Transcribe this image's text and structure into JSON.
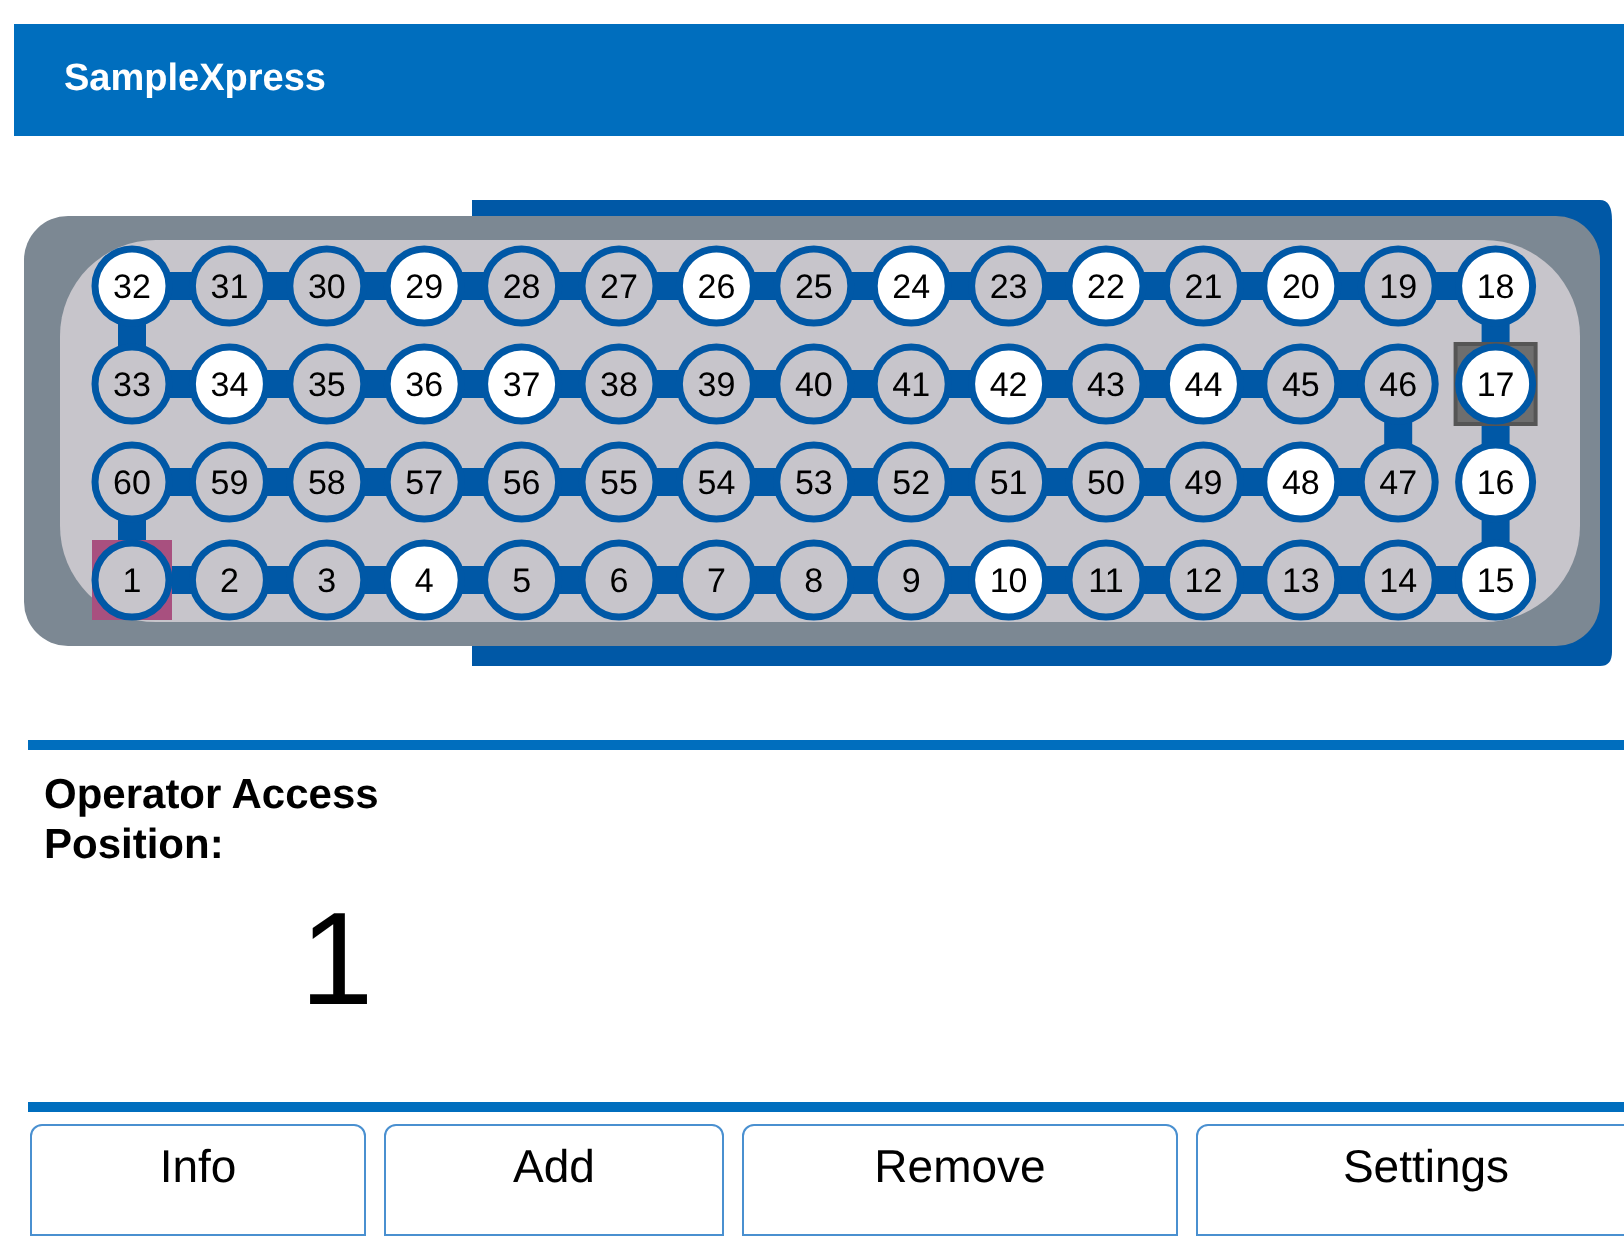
{
  "window": {
    "title": "SampleXpress"
  },
  "positions": [
    {
      "label": "32",
      "occupied": true,
      "selected": false,
      "marked": false
    },
    {
      "label": "31",
      "occupied": false,
      "selected": false,
      "marked": false
    },
    {
      "label": "30",
      "occupied": false,
      "selected": false,
      "marked": false
    },
    {
      "label": "29",
      "occupied": true,
      "selected": false,
      "marked": false
    },
    {
      "label": "28",
      "occupied": false,
      "selected": false,
      "marked": false
    },
    {
      "label": "27",
      "occupied": false,
      "selected": false,
      "marked": false
    },
    {
      "label": "26",
      "occupied": true,
      "selected": false,
      "marked": false
    },
    {
      "label": "25",
      "occupied": false,
      "selected": false,
      "marked": false
    },
    {
      "label": "24",
      "occupied": true,
      "selected": false,
      "marked": false
    },
    {
      "label": "23",
      "occupied": false,
      "selected": false,
      "marked": false
    },
    {
      "label": "22",
      "occupied": true,
      "selected": false,
      "marked": false
    },
    {
      "label": "21",
      "occupied": false,
      "selected": false,
      "marked": false
    },
    {
      "label": "20",
      "occupied": true,
      "selected": false,
      "marked": false
    },
    {
      "label": "19",
      "occupied": false,
      "selected": false,
      "marked": false
    },
    {
      "label": "18",
      "occupied": true,
      "selected": false,
      "marked": false
    },
    {
      "label": "33",
      "occupied": false,
      "selected": false,
      "marked": false
    },
    {
      "label": "34",
      "occupied": true,
      "selected": false,
      "marked": false
    },
    {
      "label": "35",
      "occupied": false,
      "selected": false,
      "marked": false
    },
    {
      "label": "36",
      "occupied": true,
      "selected": false,
      "marked": false
    },
    {
      "label": "37",
      "occupied": true,
      "selected": false,
      "marked": false
    },
    {
      "label": "38",
      "occupied": false,
      "selected": false,
      "marked": false
    },
    {
      "label": "39",
      "occupied": false,
      "selected": false,
      "marked": false
    },
    {
      "label": "40",
      "occupied": false,
      "selected": false,
      "marked": false
    },
    {
      "label": "41",
      "occupied": false,
      "selected": false,
      "marked": false
    },
    {
      "label": "42",
      "occupied": true,
      "selected": false,
      "marked": false
    },
    {
      "label": "43",
      "occupied": false,
      "selected": false,
      "marked": false
    },
    {
      "label": "44",
      "occupied": true,
      "selected": false,
      "marked": false
    },
    {
      "label": "45",
      "occupied": false,
      "selected": false,
      "marked": false
    },
    {
      "label": "46",
      "occupied": false,
      "selected": false,
      "marked": false
    },
    {
      "label": "17",
      "occupied": true,
      "selected": false,
      "marked": true
    },
    {
      "label": "60",
      "occupied": false,
      "selected": false,
      "marked": false
    },
    {
      "label": "59",
      "occupied": false,
      "selected": false,
      "marked": false
    },
    {
      "label": "58",
      "occupied": false,
      "selected": false,
      "marked": false
    },
    {
      "label": "57",
      "occupied": false,
      "selected": false,
      "marked": false
    },
    {
      "label": "56",
      "occupied": false,
      "selected": false,
      "marked": false
    },
    {
      "label": "55",
      "occupied": false,
      "selected": false,
      "marked": false
    },
    {
      "label": "54",
      "occupied": false,
      "selected": false,
      "marked": false
    },
    {
      "label": "53",
      "occupied": false,
      "selected": false,
      "marked": false
    },
    {
      "label": "52",
      "occupied": false,
      "selected": false,
      "marked": false
    },
    {
      "label": "51",
      "occupied": false,
      "selected": false,
      "marked": false
    },
    {
      "label": "50",
      "occupied": false,
      "selected": false,
      "marked": false
    },
    {
      "label": "49",
      "occupied": false,
      "selected": false,
      "marked": false
    },
    {
      "label": "48",
      "occupied": true,
      "selected": false,
      "marked": false
    },
    {
      "label": "47",
      "occupied": false,
      "selected": false,
      "marked": false
    },
    {
      "label": "16",
      "occupied": true,
      "selected": false,
      "marked": false
    },
    {
      "label": "1",
      "occupied": false,
      "selected": true,
      "marked": false
    },
    {
      "label": "2",
      "occupied": false,
      "selected": false,
      "marked": false
    },
    {
      "label": "3",
      "occupied": false,
      "selected": false,
      "marked": false
    },
    {
      "label": "4",
      "occupied": true,
      "selected": false,
      "marked": false
    },
    {
      "label": "5",
      "occupied": false,
      "selected": false,
      "marked": false
    },
    {
      "label": "6",
      "occupied": false,
      "selected": false,
      "marked": false
    },
    {
      "label": "7",
      "occupied": false,
      "selected": false,
      "marked": false
    },
    {
      "label": "8",
      "occupied": false,
      "selected": false,
      "marked": false
    },
    {
      "label": "9",
      "occupied": false,
      "selected": false,
      "marked": false
    },
    {
      "label": "10",
      "occupied": true,
      "selected": false,
      "marked": false
    },
    {
      "label": "11",
      "occupied": false,
      "selected": false,
      "marked": false
    },
    {
      "label": "12",
      "occupied": false,
      "selected": false,
      "marked": false
    },
    {
      "label": "13",
      "occupied": false,
      "selected": false,
      "marked": false
    },
    {
      "label": "14",
      "occupied": false,
      "selected": false,
      "marked": false
    },
    {
      "label": "15",
      "occupied": true,
      "selected": false,
      "marked": false
    }
  ],
  "access": {
    "label": "Operator Access Position:",
    "value": "1"
  },
  "buttons": [
    "Info",
    "Add",
    "Remove",
    "Settings"
  ]
}
